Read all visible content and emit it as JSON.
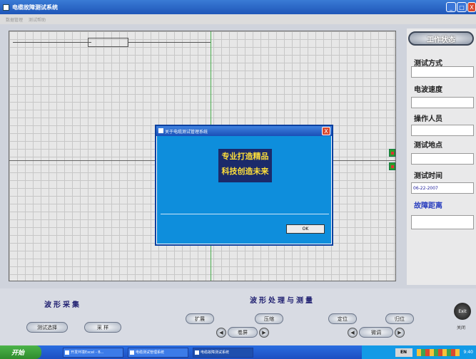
{
  "window": {
    "title": "电缆故障测试系统",
    "minimize": "_",
    "maximize": "□",
    "close": "X"
  },
  "menu": [
    "数据管理",
    "测试帮助"
  ],
  "side_panel": {
    "status_button": "工作状态",
    "fields": [
      {
        "label": "测试方式",
        "value": ""
      },
      {
        "label": "电波速度",
        "value": ""
      },
      {
        "label": "操作人员",
        "value": ""
      },
      {
        "label": "测试地点",
        "value": ""
      },
      {
        "label": "测试时间",
        "value": "06-22-2007"
      }
    ],
    "distance_label": "故障距离",
    "distance_value": ""
  },
  "dialog": {
    "title": "关于电缆测试管理系统",
    "close": "X",
    "slogan_line1": "专业打造精品",
    "slogan_line2": "科技创造未来",
    "ok": "OK"
  },
  "acquisition": {
    "title": "波形采集",
    "test_select": "测试选择",
    "sample": "采 样"
  },
  "processing": {
    "title": "波形处理与测量",
    "expand": "扩展",
    "compress": "压缩",
    "locate": "定位",
    "reset": "归位",
    "flip": "卷屏",
    "fine_tune": "微调",
    "arrow_left": "◀",
    "arrow_right": "▶"
  },
  "exit": {
    "label": "Exit",
    "caption": "关闭"
  },
  "taskbar": {
    "start": "开始",
    "tasks": [
      "开发环境Excel - B...",
      "电缆测试管理系统",
      "电缆故障测试系统"
    ],
    "lang": "EN",
    "time": "9:40"
  }
}
